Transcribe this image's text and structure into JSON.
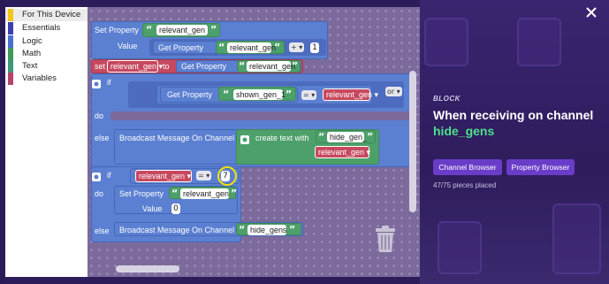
{
  "categories": [
    {
      "label": "For This Device",
      "color": "#f5c518",
      "selected": true
    },
    {
      "label": "Essentials",
      "color": "#3b3fb0"
    },
    {
      "label": "Logic",
      "color": "#4a6fd0"
    },
    {
      "label": "Math",
      "color": "#3e9a58"
    },
    {
      "label": "Text",
      "color": "#3a9a7a"
    },
    {
      "label": "Variables",
      "color": "#b8446a"
    }
  ],
  "blocks": {
    "set_property": "Set Property",
    "value": "Value",
    "get_property": "Get Property",
    "relevant_gen": "relevant_gen",
    "plus_op": "+",
    "one": "1",
    "set": "set",
    "to": "to",
    "if": "if",
    "do": "do",
    "else": "else",
    "shown_gen_1": "shown_gen_1",
    "eq_op": "=",
    "or_op": "or",
    "broadcast": "Broadcast Message On Channel",
    "create_text_with": "create text with",
    "hide_gen_": "hide_gen_",
    "seven": "7",
    "zero": "0",
    "hide_gens": "hide_gens"
  },
  "panel": {
    "label": "BLOCK",
    "title": "When receiving on channel",
    "channel": "hide_gens",
    "channel_browser": "Channel Browser",
    "property_browser": "Property Browser",
    "pieces": "47/75 pieces placed"
  }
}
